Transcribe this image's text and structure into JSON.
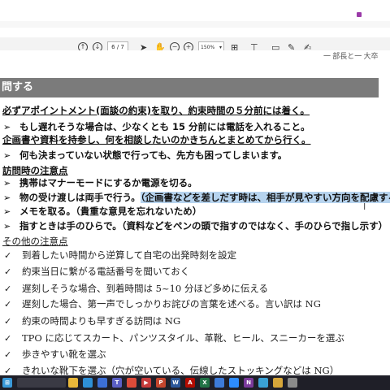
{
  "toolbar": {
    "page_current": "6",
    "page_total": "/ 7",
    "zoom": "150%",
    "icons": [
      "up-arrow-icon",
      "down-arrow-icon",
      "select-cursor-icon",
      "hand-icon",
      "zoom-out-icon",
      "zoom-in-icon",
      "fit-page-icon",
      "stamp-icon",
      "comment-icon",
      "pen-icon",
      "signature-icon"
    ]
  },
  "document": {
    "header_right": "一 部長と一 大卒",
    "section_heading": "問する",
    "lines": [
      {
        "bullet": "",
        "text": "必ずアポイントメント(面談の約束)を取り、約束時間の５分前には着く。",
        "style": "ul"
      },
      {
        "bullet": "➢",
        "text": "もし遅れそうな場合は、少なくとも 15 分前には電話を入れること。",
        "style": "bold"
      },
      {
        "bullet": "",
        "text": "企画書や資料を持参し、何を相談したいのかきちんとまとめてから行く。",
        "style": "ul"
      },
      {
        "bullet": "➢",
        "text": "何も決まっていない状態で行っても、先方も困ってしまいます。",
        "style": "bold"
      },
      {
        "bullet": "",
        "text": "訪問時の注意点",
        "style": "ul"
      },
      {
        "bullet": "➢",
        "text": "携帯はマナーモードにするか電源を切る。",
        "style": "bold"
      },
      {
        "bullet": "➢",
        "text": "物の受け渡しは両手で行う。",
        "highlight": "（企画書などを差しだす時は、相手が見やすい方向を配慮する）",
        "style": "bold"
      },
      {
        "bullet": "➢",
        "text": "メモを取る。（貴重な意見を忘れないため）",
        "style": "bold"
      },
      {
        "bullet": "➢",
        "text": "指すときは手のひらで。（資料などをペンの頭で指すのではなく、手のひらで指し示す）",
        "style": "bold"
      },
      {
        "bullet": "",
        "text": "その他の注意点",
        "style": "ul-serif"
      },
      {
        "bullet": "✓",
        "text": "到着したい時間から逆算して自宅の出発時刻を設定",
        "style": "serif"
      },
      {
        "bullet": "✓",
        "text": "約束当日に繋がる電話番号を聞いておく",
        "style": "serif"
      },
      {
        "bullet": "✓",
        "text": "遅刻しそうな場合、到着時間は 5~10 分ほど多めに伝える",
        "style": "serif"
      },
      {
        "bullet": "✓",
        "text": "遅刻した場合、第一声でしっかりお詫びの言葉を述べる。言い訳は NG",
        "style": "serif"
      },
      {
        "bullet": "✓",
        "text": "約束の時間よりも早すぎる訪問は NG",
        "style": "serif"
      },
      {
        "bullet": "✓",
        "text": "TPO に応じてスカート、パンツスタイル、革靴、ヒール、スニーカーを選ぶ",
        "style": "serif"
      },
      {
        "bullet": "✓",
        "text": "歩きやすい靴を選ぶ",
        "style": "serif"
      },
      {
        "bullet": "✓",
        "text": "きれいな靴下を選ぶ（穴が空いている、伝線したストッキングなどは NG）",
        "style": "serif"
      }
    ]
  },
  "taskbar": {
    "icons": [
      {
        "name": "windows-start-icon",
        "color": "#3a9ad9",
        "glyph": "⊞"
      },
      {
        "name": "explorer-icon",
        "color": "#e8b73a",
        "glyph": ""
      },
      {
        "name": "edge-icon",
        "color": "#2e8fd6",
        "glyph": ""
      },
      {
        "name": "store-icon",
        "color": "#3c6fd6",
        "glyph": ""
      },
      {
        "name": "teams-icon",
        "color": "#5a5fc4",
        "glyph": "T"
      },
      {
        "name": "chrome-icon",
        "color": "#dd4b39",
        "glyph": ""
      },
      {
        "name": "video-icon",
        "color": "#c73b3b",
        "glyph": "▶"
      },
      {
        "name": "powerpoint-icon",
        "color": "#c4452d",
        "glyph": "P"
      },
      {
        "name": "word-icon",
        "color": "#2b579a",
        "glyph": "W"
      },
      {
        "name": "acrobat-icon",
        "color": "#b30b00",
        "glyph": "A"
      },
      {
        "name": "excel-icon",
        "color": "#217346",
        "glyph": "X"
      },
      {
        "name": "photos-icon",
        "color": "#3d7bd9",
        "glyph": ""
      },
      {
        "name": "zoom-icon",
        "color": "#2d8cff",
        "glyph": ""
      },
      {
        "name": "onenote-icon",
        "color": "#7b3a9b",
        "glyph": "N"
      },
      {
        "name": "maps-icon",
        "color": "#3aa1d6",
        "glyph": ""
      },
      {
        "name": "pinwheel-icon",
        "color": "#d6a63a",
        "glyph": ""
      },
      {
        "name": "app-icon",
        "color": "#8a8a8a",
        "glyph": ""
      }
    ]
  }
}
